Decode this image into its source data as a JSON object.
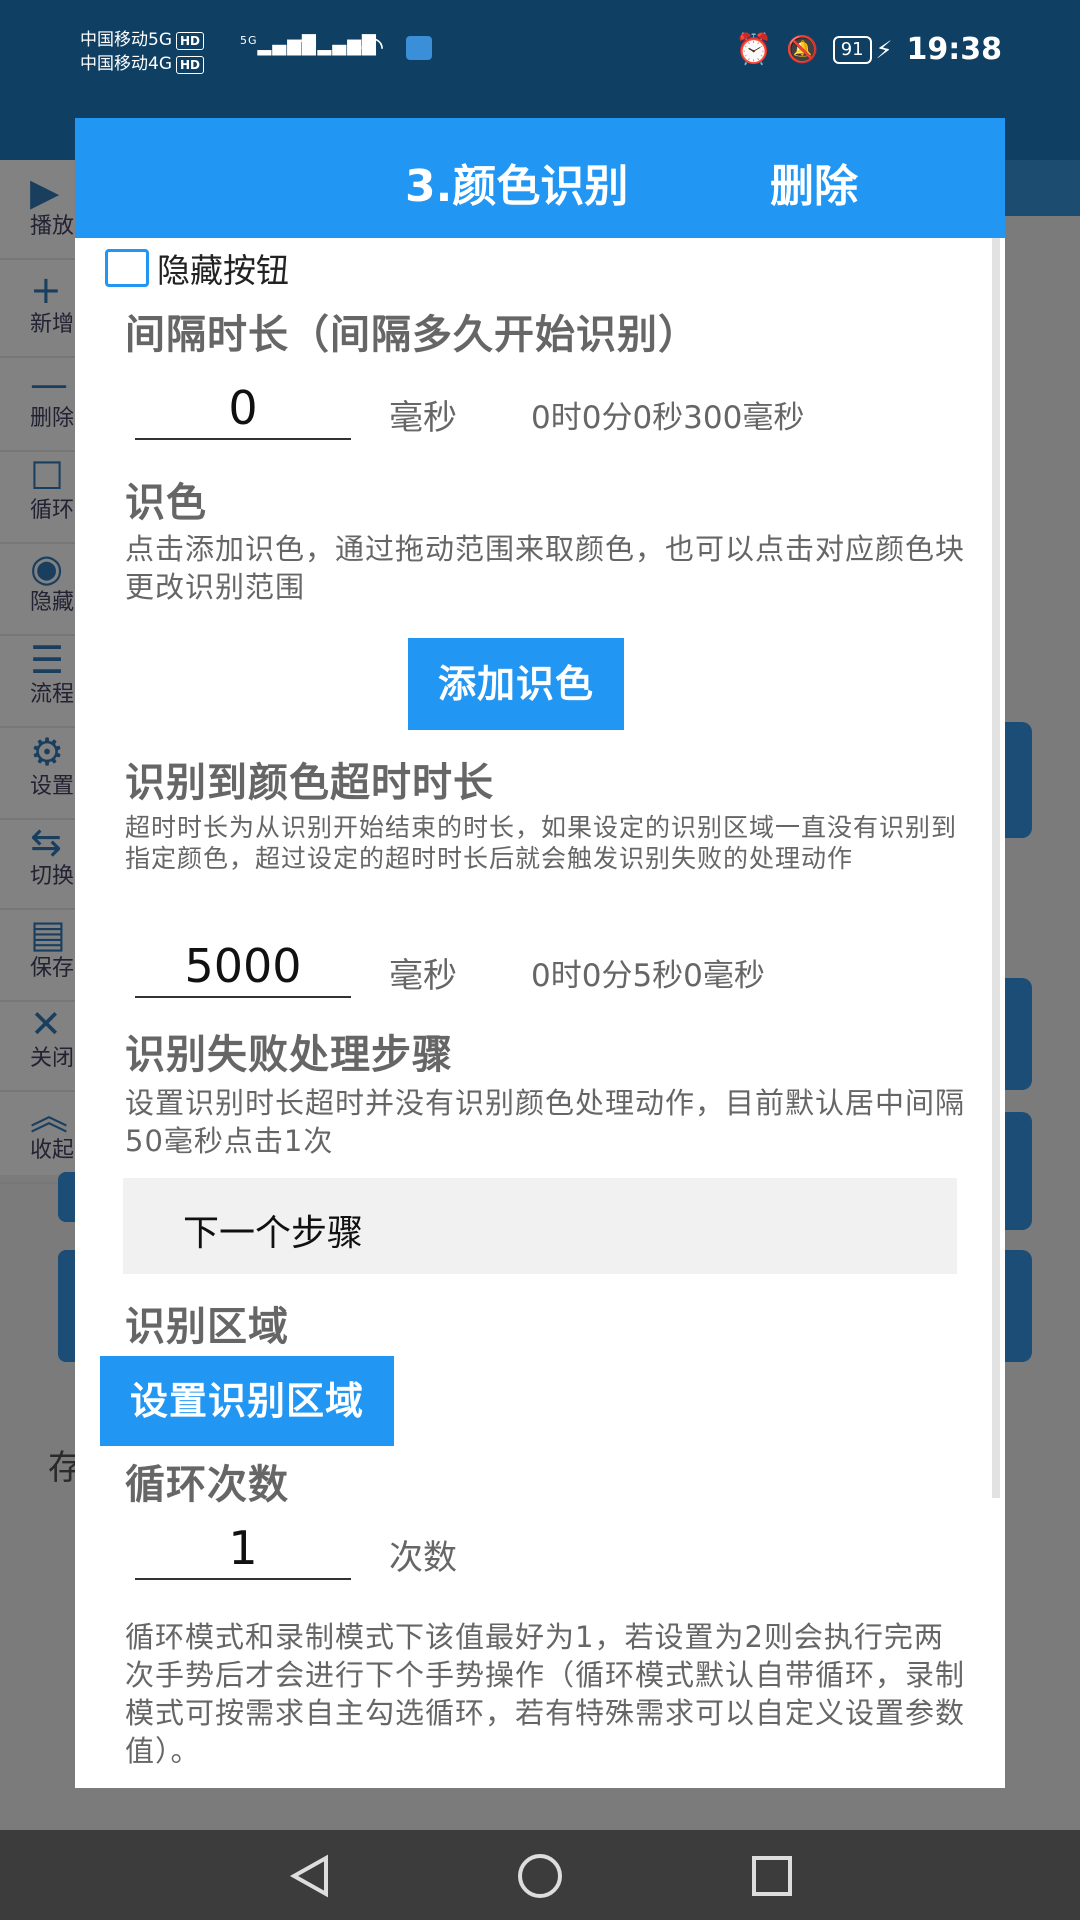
{
  "status_bar": {
    "carrier1": "中国移动5G",
    "carrier2": "中国移动4G",
    "hd": "HD",
    "sig1": "5G",
    "sig2": "4G",
    "battery": "91",
    "time": "19:38"
  },
  "side_menu": {
    "items": [
      {
        "label": "播放",
        "icon": "play-icon",
        "glyph": "▶"
      },
      {
        "label": "新增",
        "icon": "plus-icon",
        "glyph": "+"
      },
      {
        "label": "删除",
        "icon": "minus-icon",
        "glyph": "—"
      },
      {
        "label": "循环",
        "icon": "square-icon",
        "glyph": "☐"
      },
      {
        "label": "隐藏",
        "icon": "eye-icon",
        "glyph": "◉"
      },
      {
        "label": "流程",
        "icon": "list-icon",
        "glyph": "☰"
      },
      {
        "label": "设置",
        "icon": "gear-icon",
        "glyph": "⚙"
      },
      {
        "label": "切换",
        "icon": "switch-icon",
        "glyph": "⇆"
      },
      {
        "label": "保存",
        "icon": "save-icon",
        "glyph": "▤"
      },
      {
        "label": "关闭",
        "icon": "close-icon",
        "glyph": "✕"
      },
      {
        "label": "收起",
        "icon": "collapse-icon",
        "glyph": "︽"
      }
    ]
  },
  "background": {
    "partial_text": "存"
  },
  "dialog": {
    "title": "3.颜色识别",
    "delete_label": "删除",
    "hide_button_label": "隐藏按钮",
    "interval": {
      "heading": "间隔时长（间隔多久开始识别）",
      "value": "0",
      "unit": "毫秒",
      "converted": "0时0分0秒300毫秒"
    },
    "color": {
      "heading": "识色",
      "description": "点击添加识色，通过拖动范围来取颜色，也可以点击对应颜色块更改识别范围",
      "add_button": "添加识色"
    },
    "timeout": {
      "heading": "识别到颜色超时时长",
      "description": "超时时长为从识别开始结束的时长，如果设定的识别区域一直没有识别到指定颜色，超过设定的超时时长后就会触发识别失败的处理动作",
      "value": "5000",
      "unit": "毫秒",
      "converted": "0时0分5秒0毫秒"
    },
    "fail": {
      "heading": "识别失败处理步骤",
      "description": "设置识别时长超时并没有识别颜色处理动作，目前默认居中间隔50毫秒点击1次",
      "selected": "下一个步骤"
    },
    "region": {
      "heading": "识别区域",
      "button": "设置识别区域"
    },
    "loop": {
      "heading": "循环次数",
      "value": "1",
      "unit": "次数",
      "description": "循环模式和录制模式下该值最好为1，若设置为2则会执行完两次手势后才会进行下个手势操作（循环模式默认自带循环，录制模式可按需求自主勾选循环，若有特殊需求可以自定义设置参数值）。"
    }
  },
  "colors": {
    "primary": "#2196f3",
    "header": "#0f3f63"
  }
}
